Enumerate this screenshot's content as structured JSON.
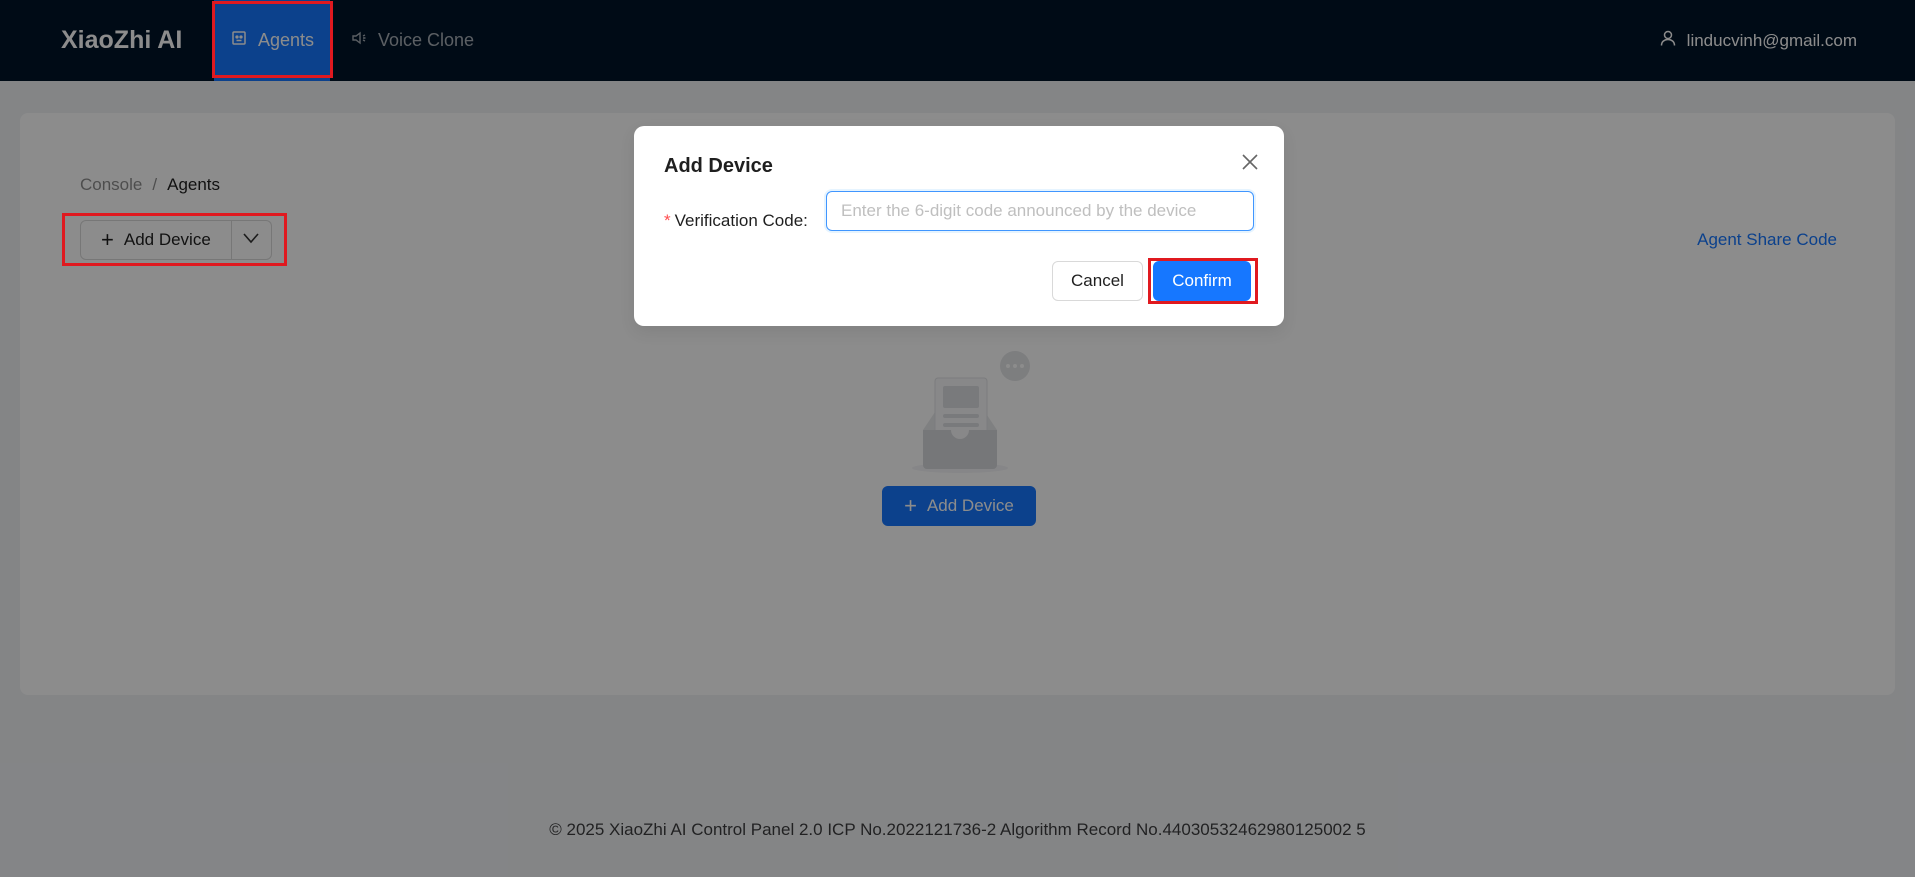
{
  "header": {
    "logo": "XiaoZhi AI",
    "nav": [
      {
        "label": "Agents",
        "icon": "robot-icon",
        "active": true
      },
      {
        "label": "Voice Clone",
        "icon": "speaker-icon",
        "active": false
      }
    ],
    "user": {
      "email": "linducvinh@gmail.com",
      "icon": "user-icon"
    }
  },
  "breadcrumb": {
    "root": "Console",
    "separator": "/",
    "current": "Agents"
  },
  "toolbar": {
    "add_device_label": "Add Device",
    "add_icon": "plus-icon",
    "dropdown_icon": "chevron-down-icon",
    "share_code_label": "Agent Share Code"
  },
  "empty_state": {
    "illustration": "empty-inbox-icon",
    "add_device_label": "Add Device"
  },
  "footer": {
    "text": "© 2025 XiaoZhi AI Control Panel 2.0 ICP No.2022121736-2 Algorithm Record No.44030532462980125002 5"
  },
  "modal": {
    "title": "Add Device",
    "field_label": "Verification Code",
    "field_colon": ":",
    "required_mark": "*",
    "input_value": "",
    "input_placeholder": "Enter the 6-digit code announced by the device",
    "cancel_label": "Cancel",
    "confirm_label": "Confirm"
  },
  "colors": {
    "header_bg": "#001529",
    "primary": "#1677ff",
    "highlight": "#e0191f",
    "required": "#ff4d4f"
  }
}
